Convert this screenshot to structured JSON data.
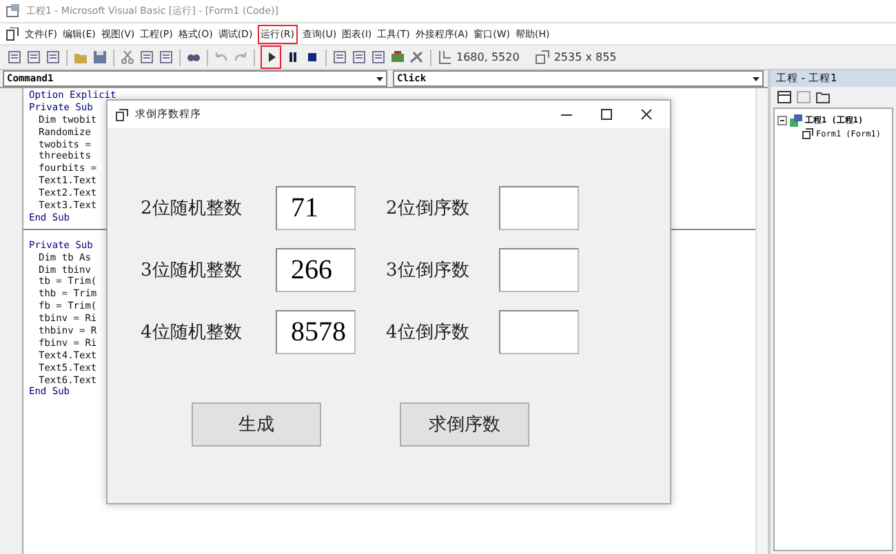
{
  "window": {
    "title": "工程1 - Microsoft Visual Basic [运行] - [Form1 (Code)]"
  },
  "menu": [
    {
      "label": "文件(F)"
    },
    {
      "label": "编辑(E)"
    },
    {
      "label": "视图(V)"
    },
    {
      "label": "工程(P)"
    },
    {
      "label": "格式(O)"
    },
    {
      "label": "调试(D)"
    },
    {
      "label": "运行(R)"
    },
    {
      "label": "查询(U)"
    },
    {
      "label": "图表(I)"
    },
    {
      "label": "工具(T)"
    },
    {
      "label": "外接程序(A)"
    },
    {
      "label": "窗口(W)"
    },
    {
      "label": "帮助(H)"
    }
  ],
  "toolbar": {
    "position": "1680, 5520",
    "size": "2535 x 855"
  },
  "code_window": {
    "object_combo": "Command1",
    "procedure_combo": "Click",
    "sections": [
      {
        "lines": [
          {
            "text": "Option Explicit"
          },
          {
            "text": "Private Sub",
            "children": [
              {
                "text": "Dim twobit"
              },
              {
                "text": "Randomize"
              },
              {
                "text": "twobits ="
              },
              {
                "text": "threebits"
              },
              {
                "text": "fourbits ="
              },
              {
                "text": "Text1.Text"
              },
              {
                "text": "Text2.Text"
              },
              {
                "text": "Text3.Text"
              }
            ]
          },
          {
            "text": "End Sub"
          }
        ]
      },
      {
        "lines": [
          {
            "text": "Private Sub",
            "children": [
              {
                "text": "Dim tb As"
              },
              {
                "text": "Dim tbinv"
              },
              {
                "text": "tb = Trim("
              },
              {
                "text": "thb = Trim"
              },
              {
                "text": "fb = Trim("
              },
              {
                "text": "tbinv = Ri"
              },
              {
                "text": "thbinv = R"
              },
              {
                "text": "fbinv = Ri"
              },
              {
                "text": "Text4.Text"
              },
              {
                "text": "Text5.Text"
              },
              {
                "text": "Text6.Text"
              }
            ]
          },
          {
            "text": "End Sub"
          }
        ]
      }
    ]
  },
  "project_panel": {
    "title": "工程 - 工程1",
    "tree": [
      {
        "label": "工程1 (工程1)",
        "expanded": true,
        "children": [
          {
            "label": "Form1 (Form1)"
          }
        ]
      }
    ]
  },
  "dialog": {
    "title": "求倒序数程序",
    "rows": [
      {
        "random_label": "2位随机整数",
        "random_value": "71",
        "reverse_label": "2位倒序数"
      },
      {
        "random_label": "3位随机整数",
        "random_value": "266",
        "reverse_label": "3位倒序数"
      },
      {
        "random_label": "4位随机整数",
        "random_value": "8578",
        "reverse_label": "4位倒序数"
      }
    ],
    "buttons": [
      "生成",
      "求倒序数"
    ]
  }
}
